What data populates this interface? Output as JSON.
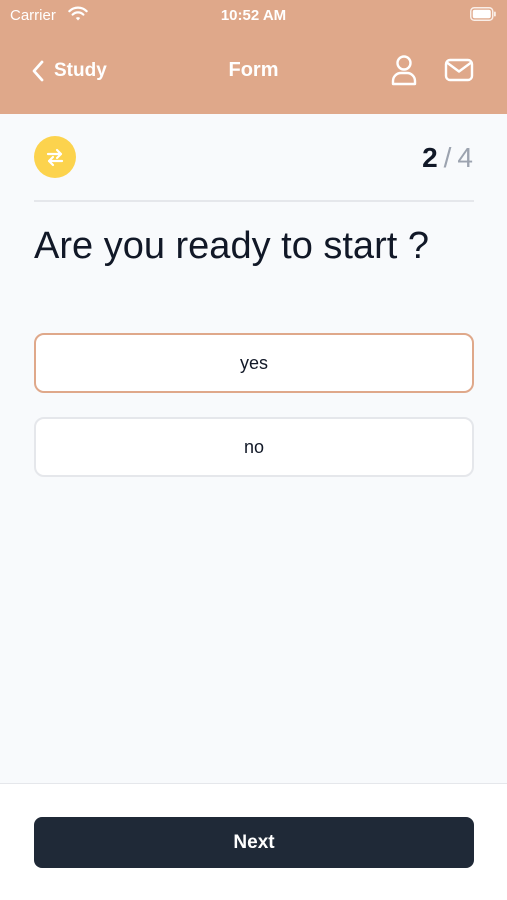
{
  "status_bar": {
    "carrier": "Carrier",
    "time": "10:52 AM",
    "wifi_icon": "wifi-icon",
    "battery_icon": "battery-icon"
  },
  "header": {
    "back_label": "Study",
    "title": "Form",
    "back_icon": "chevron-left-icon",
    "user_icon": "user-icon",
    "mail_icon": "mail-icon"
  },
  "form": {
    "badge_icon": "swap-arrows-icon",
    "progress_current": "2",
    "progress_separator": "/",
    "progress_total": "4",
    "question": "Are you ready to start ?",
    "options": [
      {
        "label": "yes",
        "selected": true
      },
      {
        "label": "no",
        "selected": false
      }
    ]
  },
  "footer": {
    "next_label": "Next"
  },
  "colors": {
    "header_bg": "#dfa88a",
    "badge_bg": "#fcd34d",
    "selected_border": "#dfa88a",
    "button_bg": "#1f2937",
    "page_bg": "#f8fafc"
  }
}
